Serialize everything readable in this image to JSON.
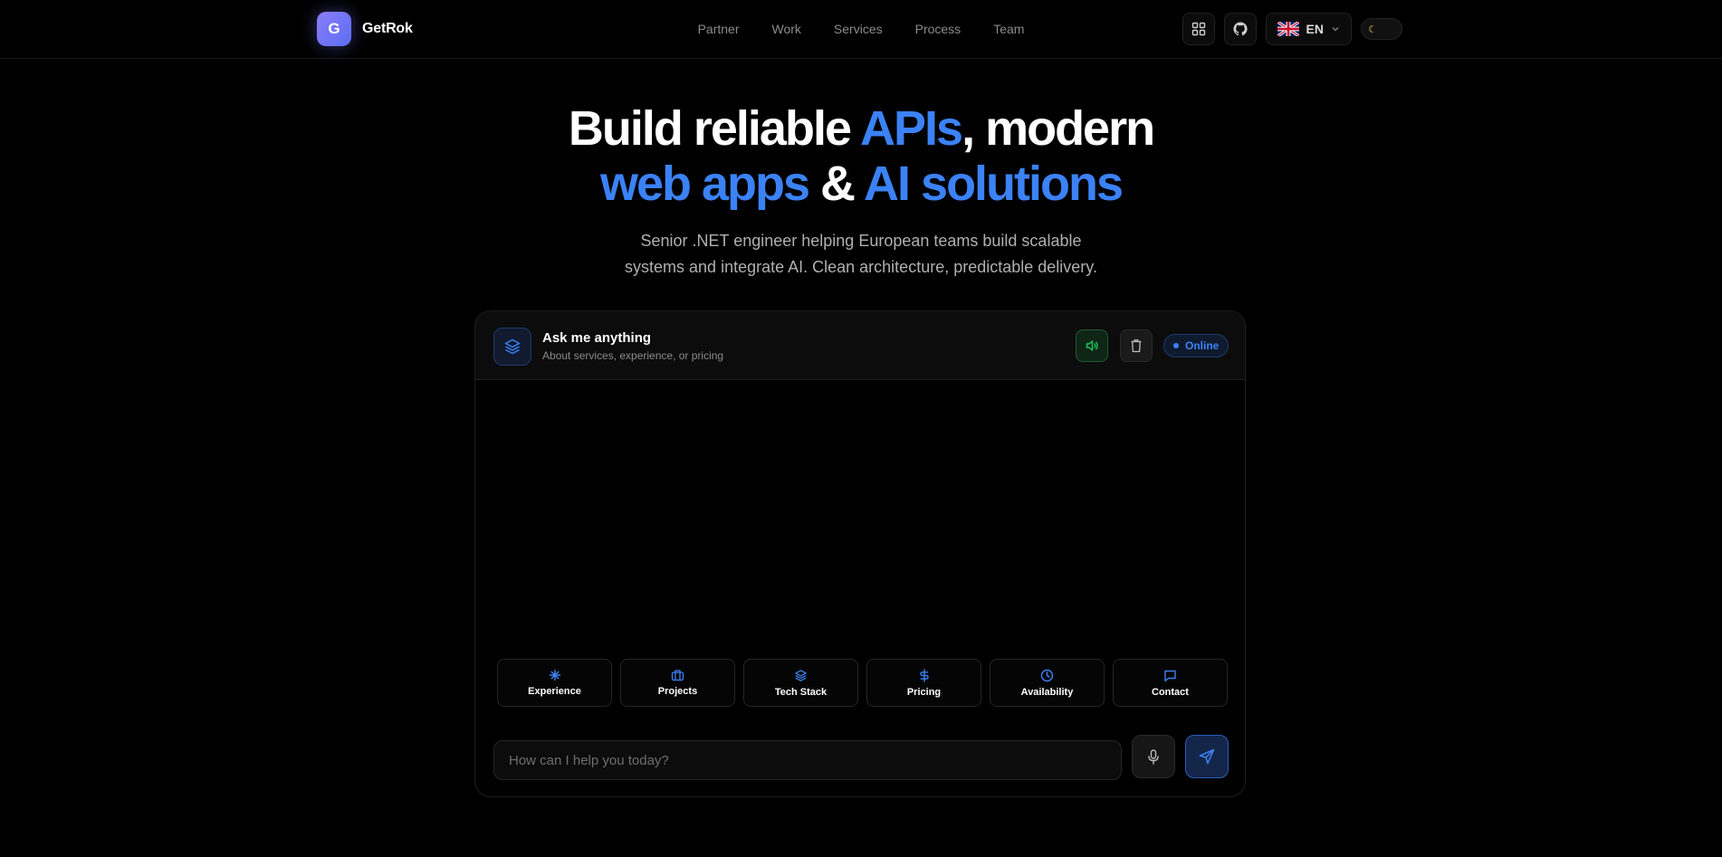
{
  "header": {
    "logo_letter": "G",
    "brand": "GetRok",
    "nav": [
      "Partner",
      "Work",
      "Services",
      "Process",
      "Team"
    ],
    "language": "EN",
    "icons": {
      "apps": "grid-icon",
      "github": "github-icon",
      "flag": "uk-flag-icon",
      "chevron": "chevron-down-icon",
      "theme": "moon-icon"
    }
  },
  "hero": {
    "title_line1_a": "Build reliable ",
    "title_line1_b": "APIs",
    "title_line1_c": ", modern",
    "title_line2_a": "web apps",
    "title_line2_b": " & ",
    "title_line2_c": "AI solutions",
    "subtitle_line1": "Senior .NET engineer helping European teams build scalable",
    "subtitle_line2": "systems and integrate AI. Clean architecture, predictable delivery."
  },
  "chat": {
    "title": "Ask me anything",
    "subtitle": "About services, experience, or pricing",
    "status": "Online",
    "quick_actions": [
      {
        "label": "Experience",
        "icon": "sparkle-icon"
      },
      {
        "label": "Projects",
        "icon": "briefcase-icon"
      },
      {
        "label": "Tech Stack",
        "icon": "layers-icon"
      },
      {
        "label": "Pricing",
        "icon": "dollar-icon"
      },
      {
        "label": "Availability",
        "icon": "clock-icon"
      },
      {
        "label": "Contact",
        "icon": "message-icon"
      }
    ],
    "input_placeholder": "How can I help you today?"
  },
  "colors": {
    "accent": "#3b82f6",
    "logo_gradient_start": "#8b7cf6",
    "logo_gradient_end": "#5b6ef5",
    "sound_green": "#22c55e"
  }
}
